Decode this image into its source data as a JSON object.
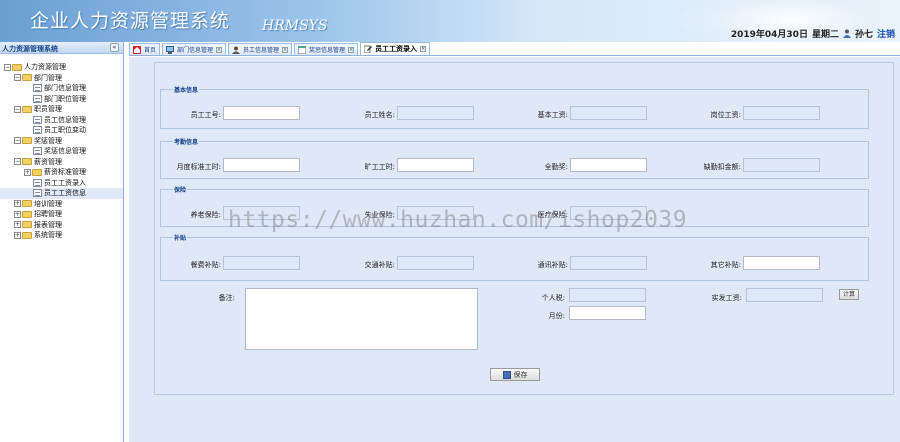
{
  "header": {
    "title": "企业人力资源管理系统",
    "subtitle": "HRMSYS",
    "date": "2019年04月30日",
    "weekday": "星期二",
    "user_name": "孙七",
    "logout_label": "注销"
  },
  "sidebar": {
    "title": "人力资源管理系统",
    "collapse_icon": "«",
    "tree": {
      "root": "人力资源管理",
      "dept_mgmt": "部门管理",
      "dept_info": "部门信息管理",
      "dept_position": "部门职位管理",
      "position_mgmt": "职员管理",
      "employee_info": "员工信息管理",
      "employee_change": "员工职位变动",
      "reward_mgmt": "奖惩管理",
      "reward_info": "奖惩信息管理",
      "salary_mgmt": "薪资管理",
      "salary_std": "薪资标准管理",
      "salary_entry": "员工工资录入",
      "salary_info": "员工工资信息",
      "training_mgmt": "培训管理",
      "recruit_mgmt": "招聘管理",
      "report_mgmt": "报表管理",
      "system_mgmt": "系统管理"
    }
  },
  "tabs": [
    {
      "label": "首页"
    },
    {
      "label": "部门信息管理"
    },
    {
      "label": "员工信息管理"
    },
    {
      "label": "奖惩信息管理"
    },
    {
      "label": "员工工资录入"
    }
  ],
  "form": {
    "basic": {
      "legend": "基本信息",
      "emp_id_label": "员工工号:",
      "emp_name_label": "员工姓名:",
      "base_salary_label": "基本工资:",
      "post_salary_label": "岗位工资:"
    },
    "attendance": {
      "legend": "考勤信息",
      "std_hours_label": "月度标准工时:",
      "absent_hours_label": "旷工工时:",
      "bonus_label": "全勤奖:",
      "deduction_label": "缺勤扣金额:"
    },
    "insurance": {
      "legend": "保险",
      "pension_label": "养老保险:",
      "unemployment_label": "失业保险:",
      "medical_label": "医疗保险:"
    },
    "subsidy": {
      "legend": "补贴",
      "meal_label": "餐费补贴:",
      "traffic_label": "交通补贴:",
      "phone_label": "通讯补贴:",
      "other_label": "其它补贴:"
    },
    "note_label": "备注:",
    "tax_label": "个人税:",
    "month_label": "月份:",
    "net_salary_label": "实发工资:",
    "calc_button": "计算",
    "save_button": "保存"
  },
  "watermark": "https://www.huzhan.com/ishop2039"
}
